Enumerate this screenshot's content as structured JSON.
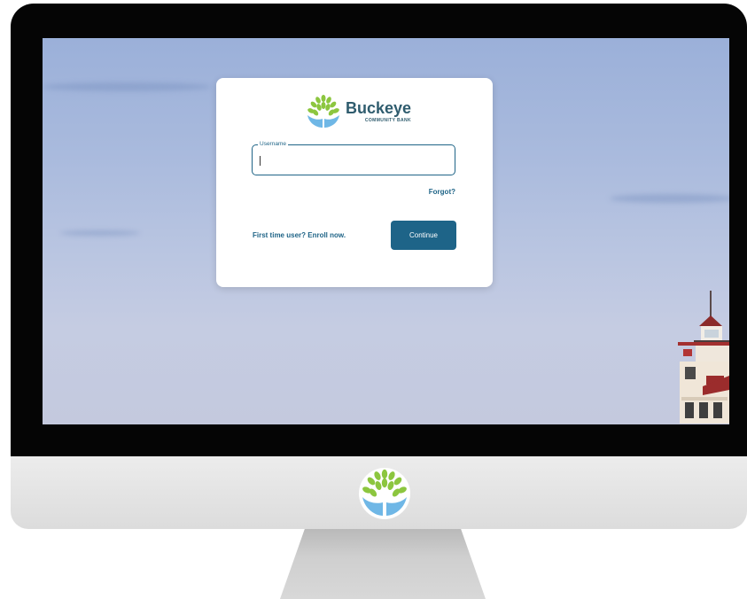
{
  "brand": {
    "name": "Buckeye",
    "subtitle": "COMMUNITY BANK"
  },
  "login": {
    "username_label": "Username",
    "username_value": "",
    "forgot_label": "Forgot?",
    "enroll_label": "First time user? Enroll now.",
    "continue_label": "Continue"
  },
  "colors": {
    "accent": "#1e6488",
    "brand_text": "#2f5c6e",
    "leaf_green": "#8cc63f",
    "hands_blue": "#6fb7e6"
  },
  "icons": {
    "logo": "tree-in-hands-icon",
    "lighthouse": "lighthouse-image"
  }
}
